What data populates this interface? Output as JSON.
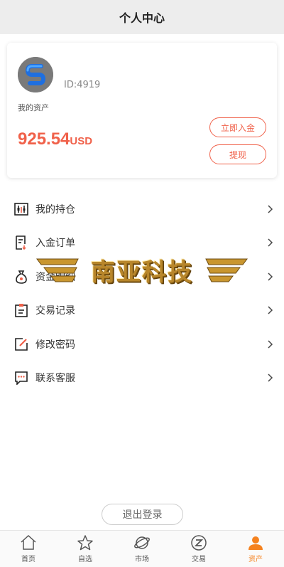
{
  "header": {
    "title": "个人中心"
  },
  "profile": {
    "user_id": "ID:4919",
    "asset_label": "我的资产",
    "balance_value": "925.54",
    "balance_currency": "USD",
    "deposit_button": "立即入金",
    "withdraw_button": "提现"
  },
  "menu": {
    "items": [
      {
        "label": "我的持仓",
        "icon": "holdings-icon"
      },
      {
        "label": "入金订单",
        "icon": "order-icon"
      },
      {
        "label": "资金明细",
        "icon": "money-bag-icon"
      },
      {
        "label": "交易记录",
        "icon": "clipboard-icon"
      },
      {
        "label": "修改密码",
        "icon": "edit-icon"
      },
      {
        "label": "联系客服",
        "icon": "chat-icon"
      }
    ]
  },
  "watermark": {
    "text": "南亚科技"
  },
  "logout_button": "退出登录",
  "tabbar": {
    "items": [
      {
        "label": "首页",
        "icon": "home-icon"
      },
      {
        "label": "自选",
        "icon": "star-icon"
      },
      {
        "label": "市场",
        "icon": "planet-icon"
      },
      {
        "label": "交易",
        "icon": "trade-icon"
      },
      {
        "label": "资产",
        "icon": "user-icon",
        "active": true
      }
    ]
  },
  "colors": {
    "accent": "#f0614a",
    "tab_active": "#f5821f",
    "header_bg": "#ededed"
  }
}
